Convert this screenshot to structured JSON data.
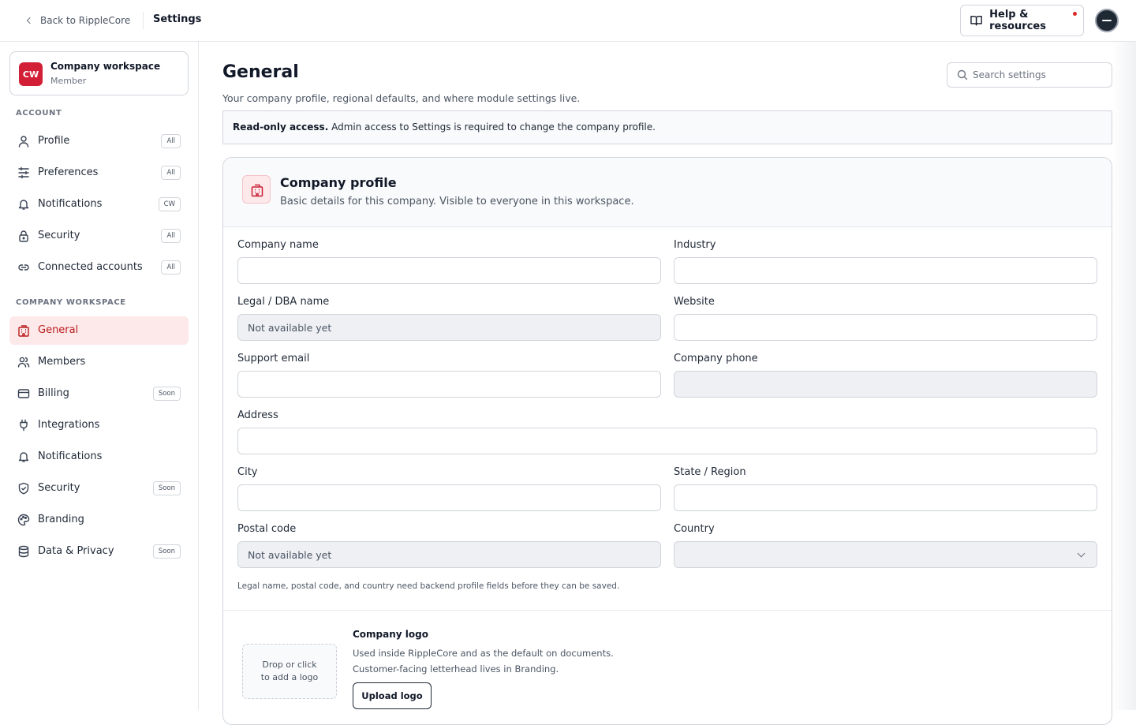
{
  "topbar": {
    "back_label": "Back to RippleCore",
    "title": "Settings",
    "help_label": "Help & resources"
  },
  "workspace": {
    "initials": "CW",
    "name": "Company workspace",
    "role": "Member"
  },
  "sidebar": {
    "account_heading": "ACCOUNT",
    "account_items": [
      {
        "label": "Profile",
        "badge": "All",
        "icon": "user-icon"
      },
      {
        "label": "Preferences",
        "badge": "All",
        "icon": "sliders-icon"
      },
      {
        "label": "Notifications",
        "badge": "CW",
        "icon": "bell-icon"
      },
      {
        "label": "Security",
        "badge": "All",
        "icon": "lock-icon"
      },
      {
        "label": "Connected accounts",
        "badge": "All",
        "icon": "link-icon"
      }
    ],
    "workspace_heading": "COMPANY WORKSPACE",
    "workspace_items": [
      {
        "label": "General",
        "badge": "",
        "icon": "building-icon",
        "active": true
      },
      {
        "label": "Members",
        "badge": "",
        "icon": "users-icon"
      },
      {
        "label": "Billing",
        "badge": "Soon",
        "icon": "credit-card-icon"
      },
      {
        "label": "Integrations",
        "badge": "",
        "icon": "plug-icon"
      },
      {
        "label": "Notifications",
        "badge": "",
        "icon": "bell-icon"
      },
      {
        "label": "Security",
        "badge": "Soon",
        "icon": "shield-icon"
      },
      {
        "label": "Branding",
        "badge": "",
        "icon": "palette-icon"
      },
      {
        "label": "Data & Privacy",
        "badge": "Soon",
        "icon": "database-icon"
      }
    ]
  },
  "page": {
    "title": "General",
    "subtitle": "Your company profile, regional defaults, and where module settings live.",
    "search_placeholder": "Search settings",
    "notice_bold": "Read-only access.",
    "notice_text": " Admin access to Settings is required to change the company profile."
  },
  "company_profile": {
    "title": "Company profile",
    "subtitle": "Basic details for this company. Visible to everyone in this workspace.",
    "fields": {
      "company_name": {
        "label": "Company name",
        "value": "",
        "placeholder": ""
      },
      "industry": {
        "label": "Industry",
        "value": "",
        "placeholder": ""
      },
      "legal_name": {
        "label": "Legal / DBA name",
        "value": "",
        "placeholder": "Not available yet"
      },
      "website": {
        "label": "Website",
        "value": "",
        "placeholder": ""
      },
      "support_email": {
        "label": "Support email",
        "value": "",
        "placeholder": ""
      },
      "company_phone": {
        "label": "Company phone",
        "value": "",
        "placeholder": ""
      },
      "address": {
        "label": "Address",
        "value": "",
        "placeholder": ""
      },
      "city": {
        "label": "City",
        "value": "",
        "placeholder": ""
      },
      "state": {
        "label": "State / Region",
        "value": "",
        "placeholder": ""
      },
      "postal_code": {
        "label": "Postal code",
        "value": "",
        "placeholder": "Not available yet"
      },
      "country": {
        "label": "Country",
        "value": "",
        "placeholder": ""
      }
    },
    "note": "Legal name, postal code, and country need backend profile fields before they can be saved."
  },
  "company_logo": {
    "drop_line1": "Drop or click",
    "drop_line2": "to add a logo",
    "title": "Company logo",
    "description": "Used inside RippleCore and as the default on documents. Customer-facing letterhead lives in Branding.",
    "upload_label": "Upload logo"
  },
  "colors": {
    "accent": "#d21f35",
    "active_bg": "#fde8ea",
    "border": "#d1d5db",
    "disabled_bg": "#eef0f4"
  }
}
